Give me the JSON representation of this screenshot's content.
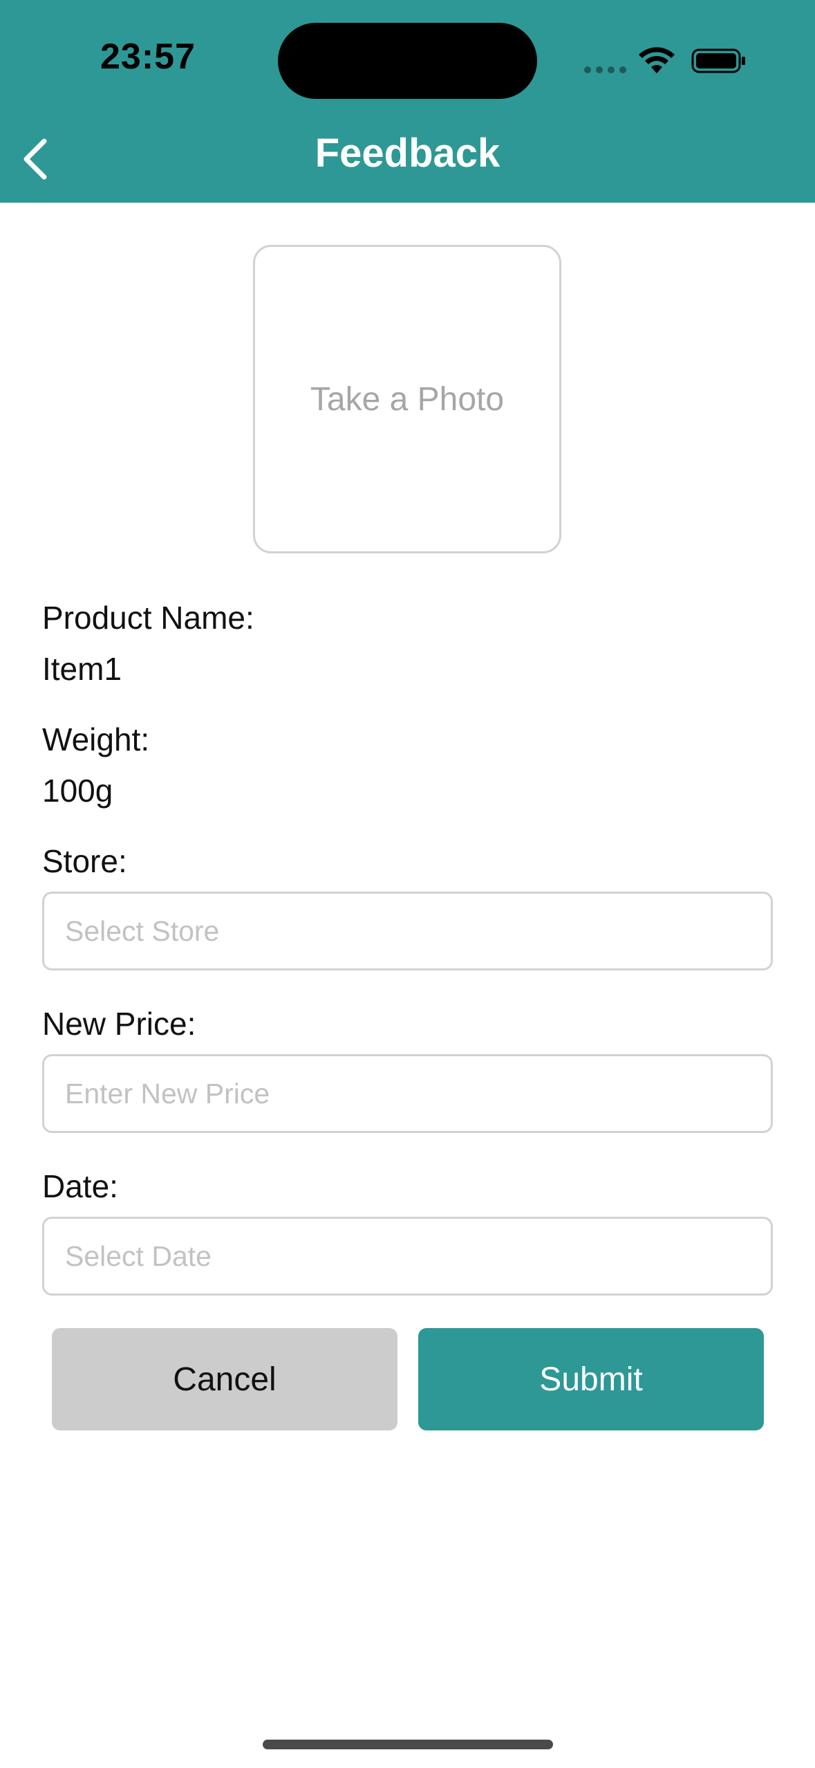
{
  "status_bar": {
    "time": "23:57"
  },
  "header": {
    "title": "Feedback",
    "back_icon": "chevron-left-icon",
    "background_color": "#2e9896"
  },
  "photo": {
    "label": "Take a Photo"
  },
  "product": {
    "name_label": "Product Name:",
    "name_value": "Item1",
    "weight_label": "Weight:",
    "weight_value": "100g"
  },
  "form": {
    "store_label": "Store:",
    "store_placeholder": "Select Store",
    "price_label": "New Price:",
    "price_placeholder": "Enter New Price",
    "date_label": "Date:",
    "date_placeholder": "Select Date"
  },
  "actions": {
    "cancel_label": "Cancel",
    "submit_label": "Submit",
    "submit_color": "#2e9896",
    "cancel_color": "#cccccc"
  }
}
